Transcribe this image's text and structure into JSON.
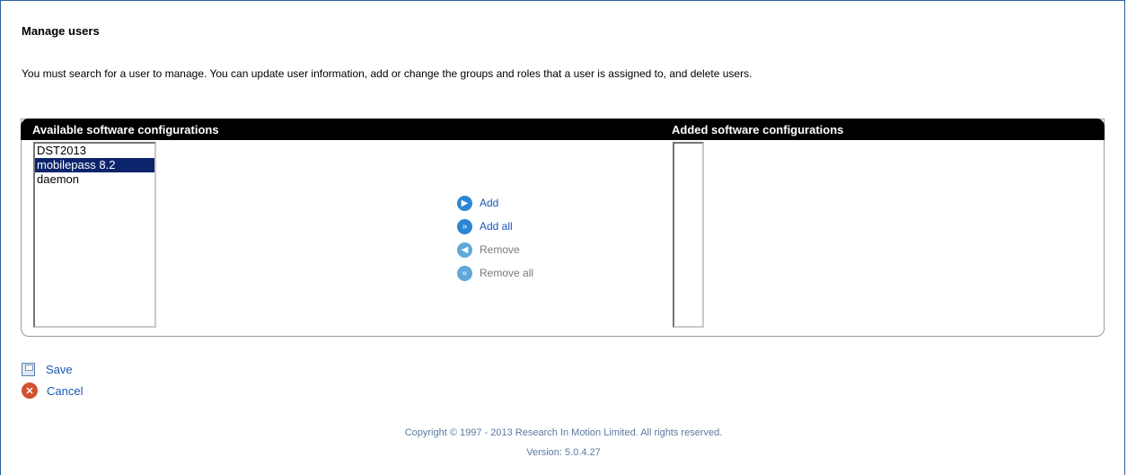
{
  "page": {
    "title": "Manage users",
    "description": "You must search for a user to manage. You can update user information, add or change the groups and roles that a user is assigned to, and delete users."
  },
  "panel": {
    "available_header": "Available software configurations",
    "added_header": "Added software configurations",
    "available_items": [
      "DST2013",
      "mobilepass 8.2",
      "daemon"
    ],
    "selected_item": "mobilepass 8.2",
    "added_items": []
  },
  "actions": {
    "add": "Add",
    "add_all": "Add all",
    "remove": "Remove",
    "remove_all": "Remove all"
  },
  "footer_actions": {
    "save": "Save",
    "cancel": "Cancel"
  },
  "footer": {
    "copyright": "Copyright © 1997 - 2013 Research In Motion Limited. All rights reserved.",
    "version": "Version: 5.0.4.27"
  },
  "colors": {
    "selection_bg": "#0b246b",
    "link": "#1a57b6",
    "header_bg": "#000000"
  },
  "icons": {
    "add": "arrow-right-circle-icon",
    "add_all": "double-arrow-right-circle-icon",
    "remove": "arrow-left-circle-icon",
    "remove_all": "double-arrow-left-circle-icon",
    "save": "floppy-disk-icon",
    "cancel": "x-circle-icon"
  }
}
